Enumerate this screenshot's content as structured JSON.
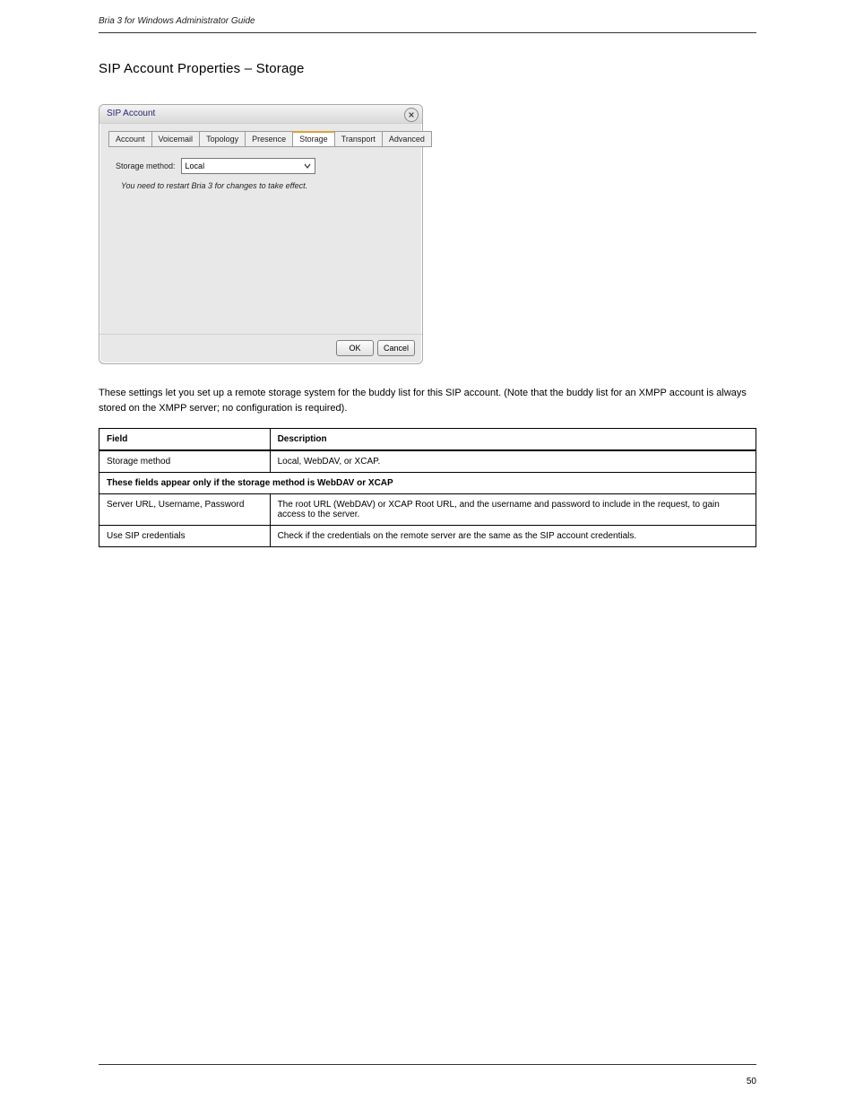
{
  "header": {
    "left": "Bria 3 for Windows Administrator Guide",
    "right": ""
  },
  "section_heading": "SIP Account Properties – Storage",
  "dialog": {
    "title": "SIP Account",
    "close_icon": "close-icon",
    "tabs": [
      {
        "id": "account",
        "label": "Account"
      },
      {
        "id": "voicemail",
        "label": "Voicemail"
      },
      {
        "id": "topology",
        "label": "Topology"
      },
      {
        "id": "presence",
        "label": "Presence"
      },
      {
        "id": "storage",
        "label": "Storage",
        "selected": true
      },
      {
        "id": "transport",
        "label": "Transport"
      },
      {
        "id": "advanced",
        "label": "Advanced"
      }
    ],
    "storage_label": "Storage method:",
    "storage_value": "Local",
    "hint": "You need to restart Bria 3 for changes to take effect.",
    "ok_label": "OK",
    "cancel_label": "Cancel"
  },
  "intro": "These settings let you set up a remote storage system for the buddy list for this SIP account. (Note that the buddy list for an XMPP account is always stored on the XMPP server; no configuration is required).",
  "table": {
    "head": {
      "field": "Field",
      "desc": "Description"
    },
    "rows": [
      {
        "field": "Storage method",
        "desc": "Local, WebDAV, or XCAP."
      },
      {
        "type": "section",
        "text": "These fields appear only if the storage method is WebDAV or XCAP"
      },
      {
        "field": "Server URL, Username, Password",
        "desc": "The root URL (WebDAV) or XCAP Root URL, and the username and password to include in the request, to gain access to the server."
      },
      {
        "field": "Use SIP credentials",
        "desc": "Check if the credentials on the remote server are the same as the SIP account credentials."
      }
    ]
  },
  "footer": {
    "page": "50"
  }
}
